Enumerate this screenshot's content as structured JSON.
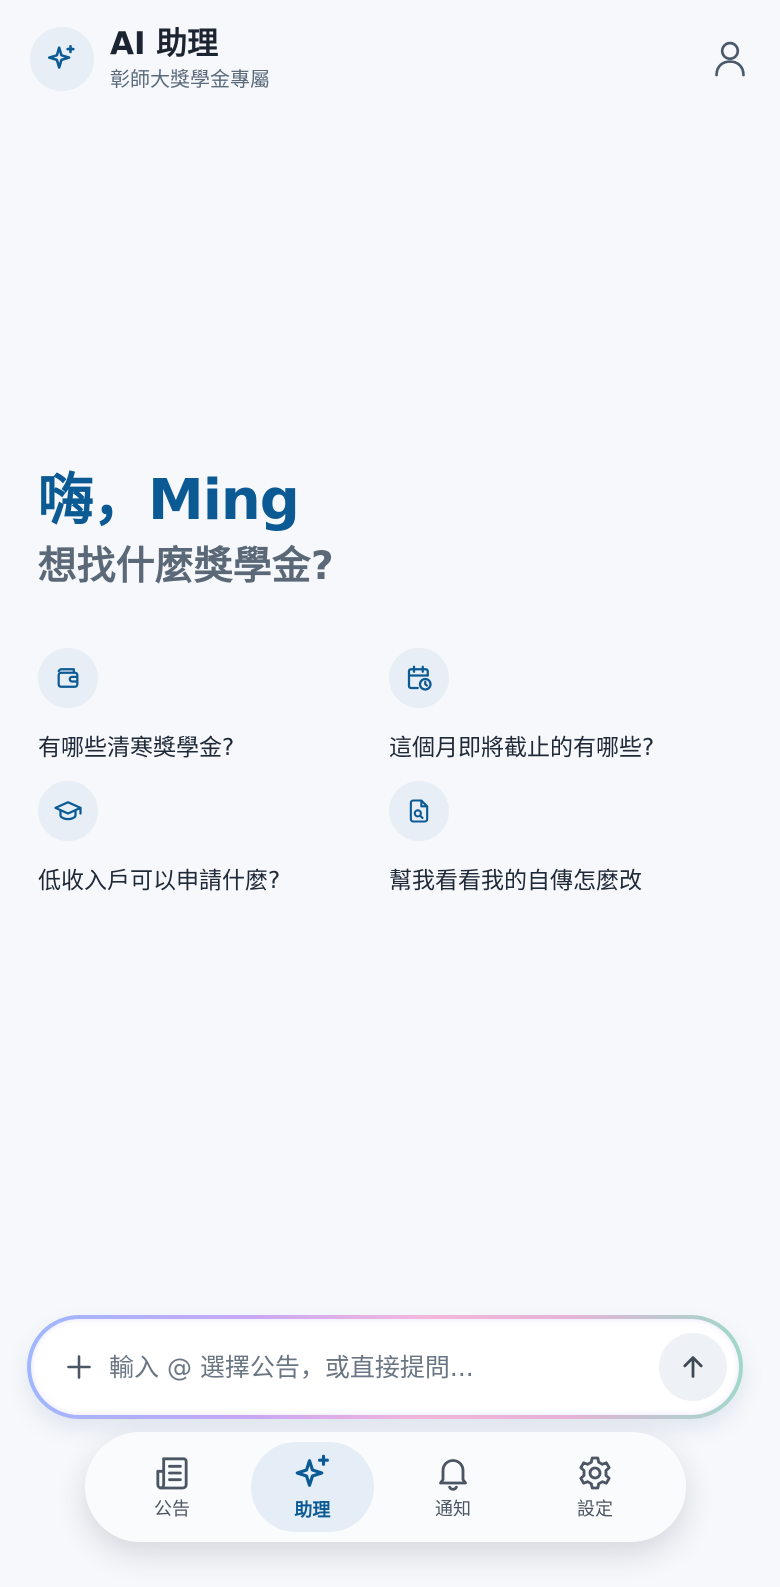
{
  "header": {
    "title": "AI 助理",
    "subtitle": "彰師大獎學金專屬",
    "logo_icon": "sparkles-icon",
    "profile_icon": "user-icon"
  },
  "greeting": {
    "line1": "嗨，Ming",
    "line2": "想找什麼獎學金?"
  },
  "suggestions": [
    {
      "icon": "wallet-icon",
      "label": "有哪些清寒獎學金?"
    },
    {
      "icon": "calendar-clock-icon",
      "label": "這個月即將截止的有哪些?"
    },
    {
      "icon": "graduation-cap-icon",
      "label": "低收入戶可以申請什麼?"
    },
    {
      "icon": "file-search-icon",
      "label": "幫我看看我的自傳怎麼改"
    }
  ],
  "composer": {
    "placeholder": "輸入 @ 選擇公告，或直接提問...",
    "value": "",
    "plus_icon": "plus-icon",
    "send_icon": "arrow-up-icon"
  },
  "nav": {
    "items": [
      {
        "label": "公告",
        "icon": "newspaper-icon",
        "active": false
      },
      {
        "label": "助理",
        "icon": "sparkles-icon",
        "active": true
      },
      {
        "label": "通知",
        "icon": "bell-icon",
        "active": false
      },
      {
        "label": "設定",
        "icon": "gear-icon",
        "active": false
      }
    ]
  },
  "colors": {
    "accent": "#0b5a94",
    "background": "#f6f8fb",
    "muted_text": "#5a6878"
  }
}
